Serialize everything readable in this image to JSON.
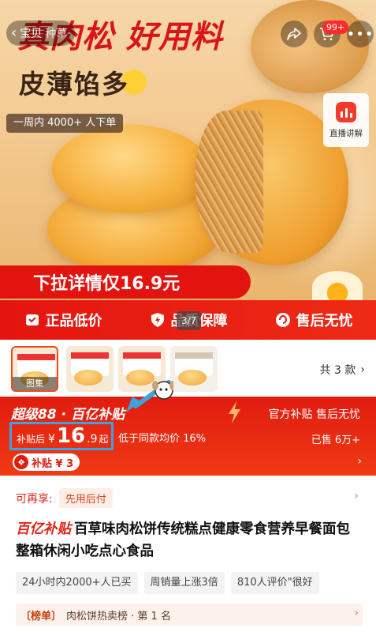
{
  "nav": {
    "back_label": "宝贝",
    "seed_label": "种草",
    "cart_badge": "99+",
    "more_icon": "more-dots-icon"
  },
  "hero": {
    "title": "真肉松 好用料",
    "subtitle": "皮薄馅多",
    "sales_text": "一周内 4000+ 人下单",
    "live_label": "直播讲解",
    "pull_banner": "下拉详情仅16.9元",
    "page_indicator": "3/7"
  },
  "guarantees": [
    {
      "label": "正品低价",
      "icon": "price-tag-icon"
    },
    {
      "label": "品质保障",
      "icon": "lightning-shield-icon"
    },
    {
      "label": "售后无忧",
      "icon": "service-icon"
    }
  ],
  "thumbnails": {
    "first_caption": "图集",
    "variants_text": "共 3 款"
  },
  "price": {
    "promo_tag": "超级88 · 百亿补贴",
    "official_text": "官方补贴 售后无忧",
    "prefix": "补贴后",
    "currency": "¥",
    "integer": "16",
    "decimal": ".9",
    "suffix": "起",
    "compare_text": "低于同款均价 16%",
    "sold_text": "已售 6万+",
    "subsidy_text": "补贴 ¥ 3"
  },
  "info": {
    "pay_label": "可再享:",
    "pay_chip": "先用后付",
    "title_tag": "百亿补贴",
    "title": "百草味肉松饼传统糕点健康零食营养早餐面包整箱休闲小吃点心食品",
    "chips": [
      "24小时内2000+人已买",
      "周销量上涨3倍",
      "810人评价\"很好"
    ],
    "rank_badge": "〔榜单〕",
    "rank_text": "肉松饼热卖榜 · 第 1 名"
  },
  "colors": {
    "accent_red": "#e3140f",
    "annotation_blue": "#3aa3e0"
  }
}
